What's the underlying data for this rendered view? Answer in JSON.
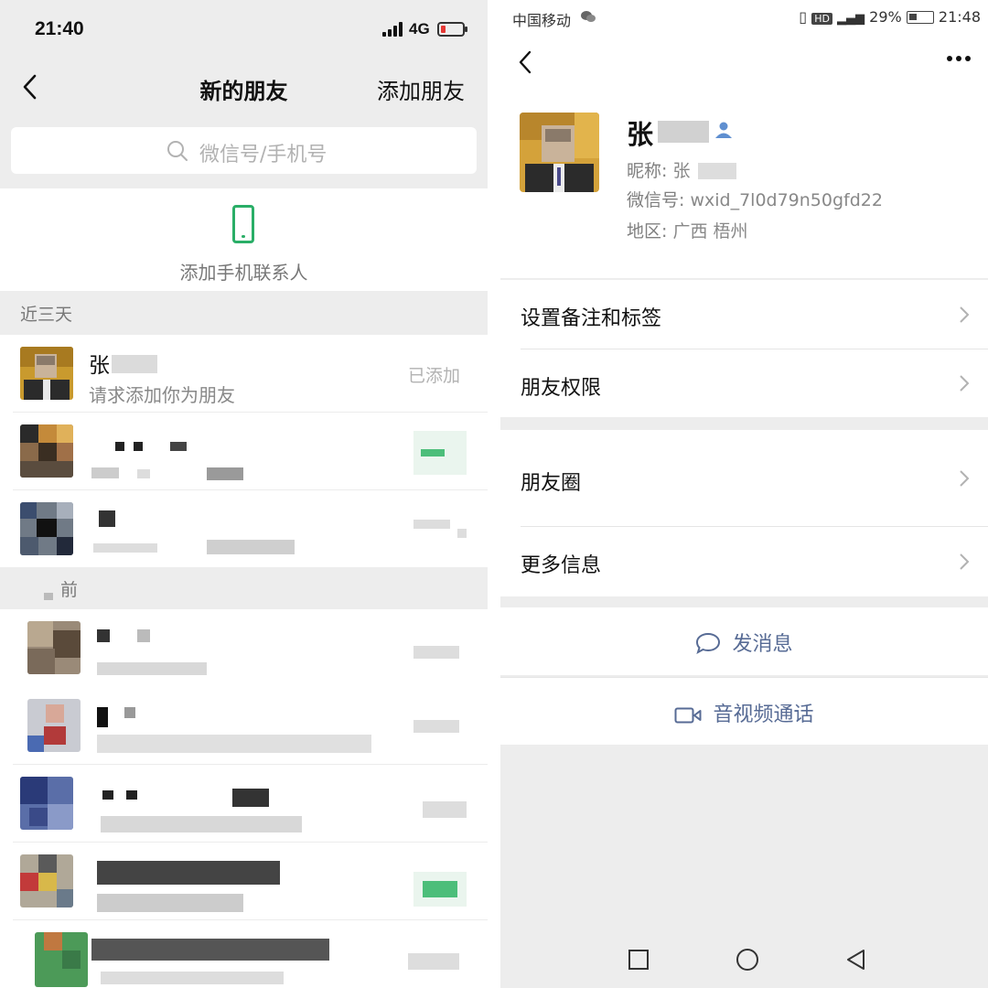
{
  "left": {
    "status": {
      "time": "21:40",
      "network": "4G"
    },
    "nav": {
      "title": "新的朋友",
      "action": "添加朋友"
    },
    "search": {
      "placeholder": "微信号/手机号"
    },
    "add_phone": {
      "label": "添加手机联系人"
    },
    "sections": {
      "recent": "近三天",
      "earlier": "前"
    },
    "requests": [
      {
        "name": "张",
        "message": "请求添加你为朋友",
        "status": "已添加"
      }
    ]
  },
  "right": {
    "status": {
      "carrier": "中国移动",
      "battery": "29%",
      "time": "21:48"
    },
    "profile": {
      "name": "张",
      "nickname_label": "昵称: ",
      "nickname": "张",
      "wechat_id_label": "微信号: ",
      "wechat_id": "wxid_7l0d79n50gfd22",
      "region_label": "地区: ",
      "region": "广西  梧州"
    },
    "menu": {
      "remark": "设置备注和标签",
      "permissions": "朋友权限",
      "moments": "朋友圈",
      "more": "更多信息"
    },
    "actions": {
      "message": "发消息",
      "call": "音视频通话"
    }
  },
  "colors": {
    "accent_green": "#2aae67",
    "link_blue": "#576b95",
    "background_gray": "#ededed"
  }
}
